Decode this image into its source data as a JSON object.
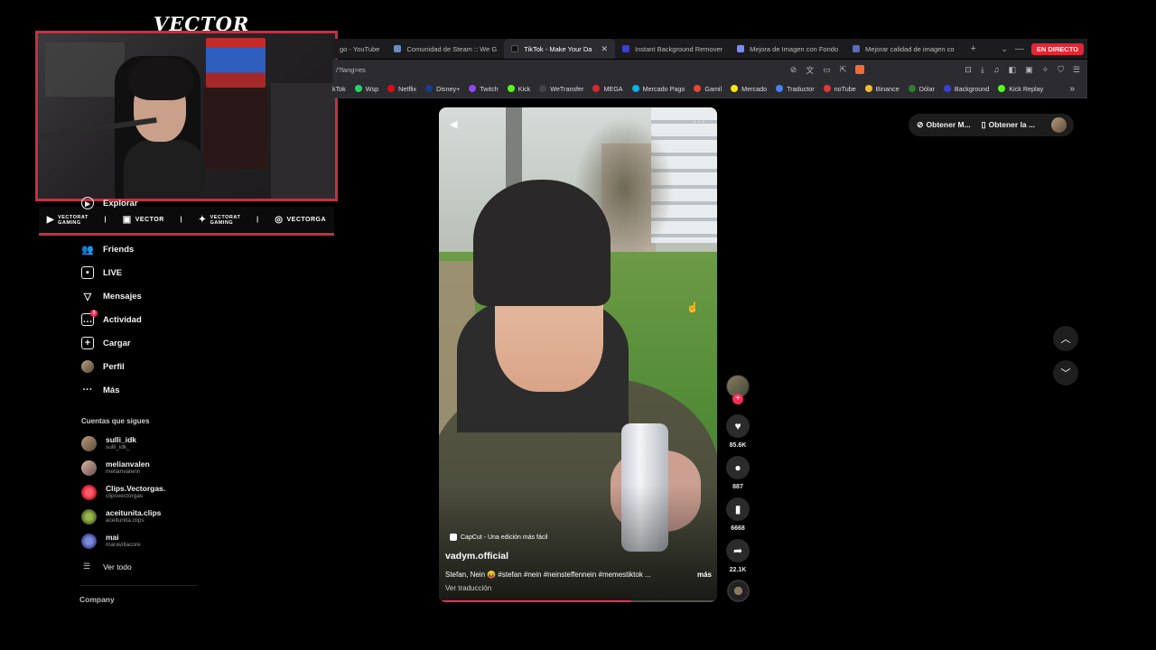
{
  "stream": {
    "logo": "VECTOR",
    "socials": [
      {
        "icon": "youtube-icon",
        "line1": "VECTORAT",
        "line2": "GAMING"
      },
      {
        "icon": "twitch-icon",
        "line1": "VECTOR",
        "line2": ""
      },
      {
        "icon": "twitter-icon",
        "line1": "VECTORAT",
        "line2": "GAMING"
      },
      {
        "icon": "instagram-icon",
        "line1": "VECTORGA",
        "line2": ""
      }
    ]
  },
  "browser": {
    "tabs": [
      {
        "label": "go - YouTube",
        "color": "#e53935"
      },
      {
        "label": "Comunidad de Steam :: We G",
        "color": "#6b8cbf"
      },
      {
        "label": "TikTok - Make Your Da",
        "color": "#111111",
        "active": true
      },
      {
        "label": "Instant Background Remover",
        "color": "#3a3fd9"
      },
      {
        "label": "Mejora de Imagen con Fondo",
        "color": "#7c8cff"
      },
      {
        "label": "Mejorar calidad de imagen co",
        "color": "#5c6bc0"
      }
    ],
    "live_badge": "EN DIRECTO",
    "url": "/?lang=es",
    "bookmarks": [
      {
        "label": "kTok",
        "color": "#111111"
      },
      {
        "label": "Wsp",
        "color": "#25d366"
      },
      {
        "label": "Netflix",
        "color": "#e50914"
      },
      {
        "label": "Disney+",
        "color": "#1a3d8f"
      },
      {
        "label": "Twitch",
        "color": "#9146ff"
      },
      {
        "label": "Kick",
        "color": "#53fc18"
      },
      {
        "label": "WeTransfer",
        "color": "#222222"
      },
      {
        "label": "MEGA",
        "color": "#d9272e"
      },
      {
        "label": "Mercado Pago",
        "color": "#00b1ea"
      },
      {
        "label": "Gamil",
        "color": "#ea4335"
      },
      {
        "label": "Mercado",
        "color": "#ffe600"
      },
      {
        "label": "Traductor",
        "color": "#4285f4"
      },
      {
        "label": "noTube",
        "color": "#e53935"
      },
      {
        "label": "Binance",
        "color": "#f3ba2f"
      },
      {
        "label": "Dólar",
        "color": "#2e7d32"
      },
      {
        "label": "Background",
        "color": "#3a3fd9"
      },
      {
        "label": "Kick Replay",
        "color": "#53fc18"
      }
    ]
  },
  "sidebar": {
    "explore": "Explorar",
    "items": [
      {
        "label": "Friends",
        "icon": "friends-icon"
      },
      {
        "label": "LIVE",
        "icon": "live-icon"
      },
      {
        "label": "Mensajes",
        "icon": "messages-icon"
      },
      {
        "label": "Actividad",
        "icon": "activity-icon",
        "badge": "3"
      },
      {
        "label": "Cargar",
        "icon": "upload-icon"
      },
      {
        "label": "Perfil",
        "icon": "profile-avatar"
      },
      {
        "label": "Más",
        "icon": "more-icon"
      }
    ],
    "following_title": "Cuentas que sigues",
    "following": [
      {
        "name": "sulli_idk",
        "handle": "sulli_idk_"
      },
      {
        "name": "melianvalen",
        "handle": "melianvalenn"
      },
      {
        "name": "Clips.Vectorgas.",
        "handle": "clipsvectorgas"
      },
      {
        "name": "aceitunita.clips",
        "handle": "aceitunita.clips"
      },
      {
        "name": "mai",
        "handle": "maravillacore"
      }
    ],
    "view_all": "Ver todo",
    "company": "Company"
  },
  "video": {
    "capcut": "CapCut - Una edición más fácil",
    "username": "vadym.official",
    "description": "Stefan, Nein 😝 #stefan #nein #neinsteffennein #memestiktok ...",
    "more": "más",
    "translate": "Ver traducción",
    "progress": 0.69
  },
  "actions": {
    "likes": "85.6K",
    "comments": "887",
    "saves": "6668",
    "shares": "22.1K"
  },
  "top_right": {
    "get_app_1": "Obtener M...",
    "get_app_2": "Obtener la ..."
  }
}
